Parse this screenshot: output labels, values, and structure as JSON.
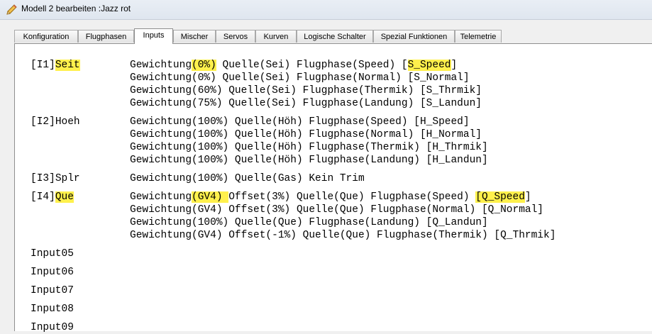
{
  "window": {
    "title": "Modell 2 bearbeiten :Jazz rot"
  },
  "tabs": [
    {
      "label": "Konfiguration"
    },
    {
      "label": "Flugphasen"
    },
    {
      "label": "Inputs",
      "active": true
    },
    {
      "label": "Mischer"
    },
    {
      "label": "Servos"
    },
    {
      "label": "Kurven"
    },
    {
      "label": "Logische Schalter"
    },
    {
      "label": "Spezial Funktionen"
    },
    {
      "label": "Telemetrie"
    }
  ],
  "inputs": [
    {
      "label_prefix": "[I1]",
      "label_name": "Seit",
      "label_highlight": true,
      "lines": [
        [
          "Gewichtung",
          {
            "t": "(0%)",
            "hl": true
          },
          " Quelle(Sei) Flugphase(Speed) [",
          {
            "t": "S_Speed",
            "hl": true
          },
          "]"
        ],
        [
          "Gewichtung(0%) Quelle(Sei) Flugphase(Normal) [S_Normal]"
        ],
        [
          "Gewichtung(60%) Quelle(Sei) Flugphase(Thermik) [S_Thrmik]"
        ],
        [
          "Gewichtung(75%) Quelle(Sei) Flugphase(Landung) [S_Landun]"
        ]
      ]
    },
    {
      "label_prefix": "[I2]",
      "label_name": "Hoeh",
      "label_highlight": false,
      "lines": [
        [
          "Gewichtung(100%) Quelle(Höh) Flugphase(Speed) [H_Speed]"
        ],
        [
          "Gewichtung(100%) Quelle(Höh) Flugphase(Normal) [H_Normal]"
        ],
        [
          "Gewichtung(100%) Quelle(Höh) Flugphase(Thermik) [H_Thrmik]"
        ],
        [
          "Gewichtung(100%) Quelle(Höh) Flugphase(Landung) [H_Landun]"
        ]
      ]
    },
    {
      "label_prefix": "[I3]",
      "label_name": "Splr",
      "label_highlight": false,
      "lines": [
        [
          "Gewichtung(100%) Quelle(Gas) Kein Trim"
        ]
      ]
    },
    {
      "label_prefix": "[I4]",
      "label_name": "Que",
      "label_highlight": true,
      "lines": [
        [
          "Gewichtung",
          {
            "t": "(GV4) ",
            "hl": true
          },
          "Offset(3%) Quelle(Que) Flugphase(Speed) ",
          {
            "t": "[Q_Speed",
            "hl": true
          },
          "]"
        ],
        [
          "Gewichtung(GV4) Offset(3%) Quelle(Que) Flugphase(Normal) [Q_Normal]"
        ],
        [
          "Gewichtung(100%) Quelle(Que) Flugphase(Landung) [Q_Landun]"
        ],
        [
          "Gewichtung(GV4) Offset(-1%) Quelle(Que) Flugphase(Thermik) [Q_Thrmik]"
        ]
      ]
    }
  ],
  "empty_inputs": [
    "Input05",
    "Input06",
    "Input07",
    "Input08",
    "Input09"
  ]
}
